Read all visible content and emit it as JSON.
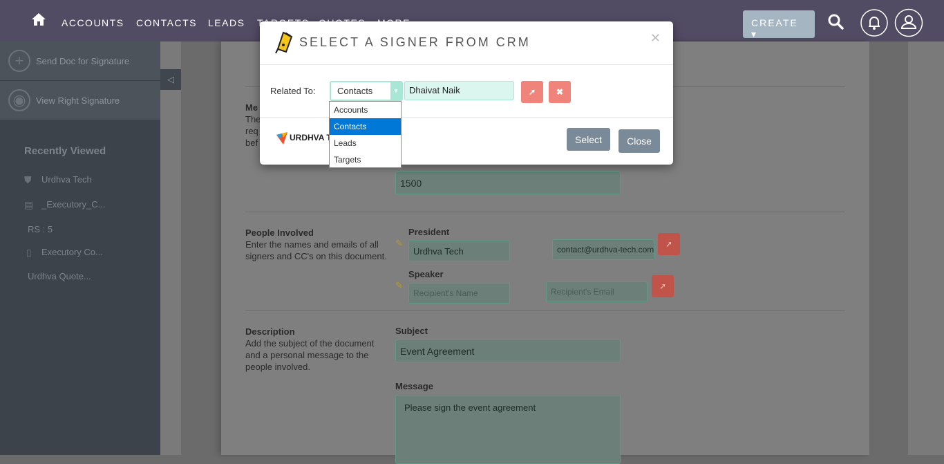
{
  "nav": {
    "items": [
      "ACCOUNTS",
      "CONTACTS",
      "LEADS",
      "TARGETS",
      "QUOTES",
      "MORE"
    ],
    "create": "CREATE ▾"
  },
  "sidebar": {
    "actions": [
      "Send Doc for Signature",
      "View Right Signature"
    ],
    "recent_title": "Recently Viewed",
    "recent": [
      "Urdhva Tech",
      "_Executory_C...",
      "RS : 5",
      "Executory Co...",
      "Urdhva Quote..."
    ]
  },
  "form": {
    "message_label": "Me",
    "message_desc": "The\nreq\nbef",
    "amount_value": "1500",
    "people_label": "People Involved",
    "people_desc": "Enter the names and emails of all signers and CC's on this document.",
    "president_label": "President",
    "president_name": "Urdhva Tech",
    "president_email": "contact@urdhva-tech.com",
    "speaker_label": "Speaker",
    "name_placeholder": "Recipient's Name",
    "email_placeholder": "Recipient's Email",
    "description_label": "Description",
    "description_desc": "Add the subject of the document and a personal message to the people involved.",
    "subject_label": "Subject",
    "subject_value": "Event Agreement",
    "message_field_label": "Message",
    "message_value": "Please sign the event agreement"
  },
  "modal": {
    "title": "SELECT A SIGNER FROM CRM",
    "related_label": "Related To:",
    "related_value": "Contacts",
    "selected_value": "Dhaivat Naik",
    "logo_text": "URDHVA TECH",
    "select": "Select",
    "close": "Close",
    "options": [
      "Accounts",
      "Contacts",
      "Leads",
      "Targets"
    ],
    "selected_option": "Contacts"
  },
  "colors": {
    "nav": "#524b64",
    "accent": "#f0847a",
    "highlight": "#0078d7"
  }
}
